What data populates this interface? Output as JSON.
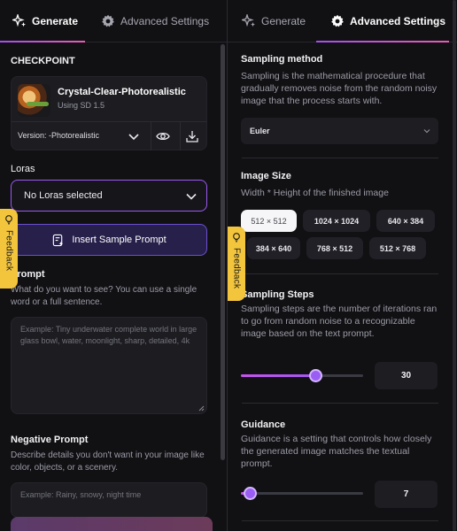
{
  "left": {
    "tabs": [
      {
        "label": "Generate",
        "icon": "sparkles-icon"
      },
      {
        "label": "Advanced Settings",
        "icon": "gear-icon"
      }
    ],
    "checkpoint": {
      "heading": "CHECKPOINT",
      "name": "Crystal-Clear-Photorealistic",
      "base": "Using SD 1.5",
      "version_label": "Version: -Photorealistic"
    },
    "loras": {
      "heading": "Loras",
      "selected": "No Loras selected"
    },
    "sample_prompt_button": "Insert Sample Prompt",
    "prompt": {
      "heading": "Prompt",
      "description": "What do you want to see? You can use a single word or a full sentence.",
      "placeholder": "Example: Tiny underwater complete world in large glass bowl, water, moonlight, sharp, detailed, 4k"
    },
    "negative_prompt": {
      "heading": "Negative Prompt",
      "description": "Describe details you don't want in your image like color, objects, or a scenery.",
      "placeholder": "Example: Rainy, snowy, night time"
    },
    "feedback_label": "Feedback"
  },
  "right": {
    "tabs": [
      {
        "label": "Generate",
        "icon": "sparkles-icon"
      },
      {
        "label": "Advanced Settings",
        "icon": "gear-icon"
      }
    ],
    "sampling_method": {
      "heading": "Sampling method",
      "description": "Sampling is the mathematical procedure that gradually removes noise from the random noisy image that the process starts with.",
      "selected": "Euler"
    },
    "image_size": {
      "heading": "Image Size",
      "description": "Width * Height of the finished image",
      "options": [
        "512 × 512",
        "1024 × 1024",
        "640 × 384",
        "384 × 640",
        "768 × 512",
        "512 × 768"
      ],
      "selected_index": 0
    },
    "sampling_steps": {
      "heading": "Sampling Steps",
      "description": "Sampling steps are the number of iterations ran to go from random noise to a recognizable image based on the text prompt.",
      "value": "30",
      "slider_fraction": 0.61
    },
    "guidance": {
      "heading": "Guidance",
      "description": "Guidance is a setting that controls how closely the generated image matches the textual prompt.",
      "value": "7",
      "slider_fraction": 0.07
    },
    "feedback_label": "Feedback"
  },
  "colors": {
    "accent_purple": "#9b5ef4",
    "accent_pink": "#e95cb4",
    "feedback_yellow": "#f3c53c",
    "panel_bg": "#111114"
  }
}
